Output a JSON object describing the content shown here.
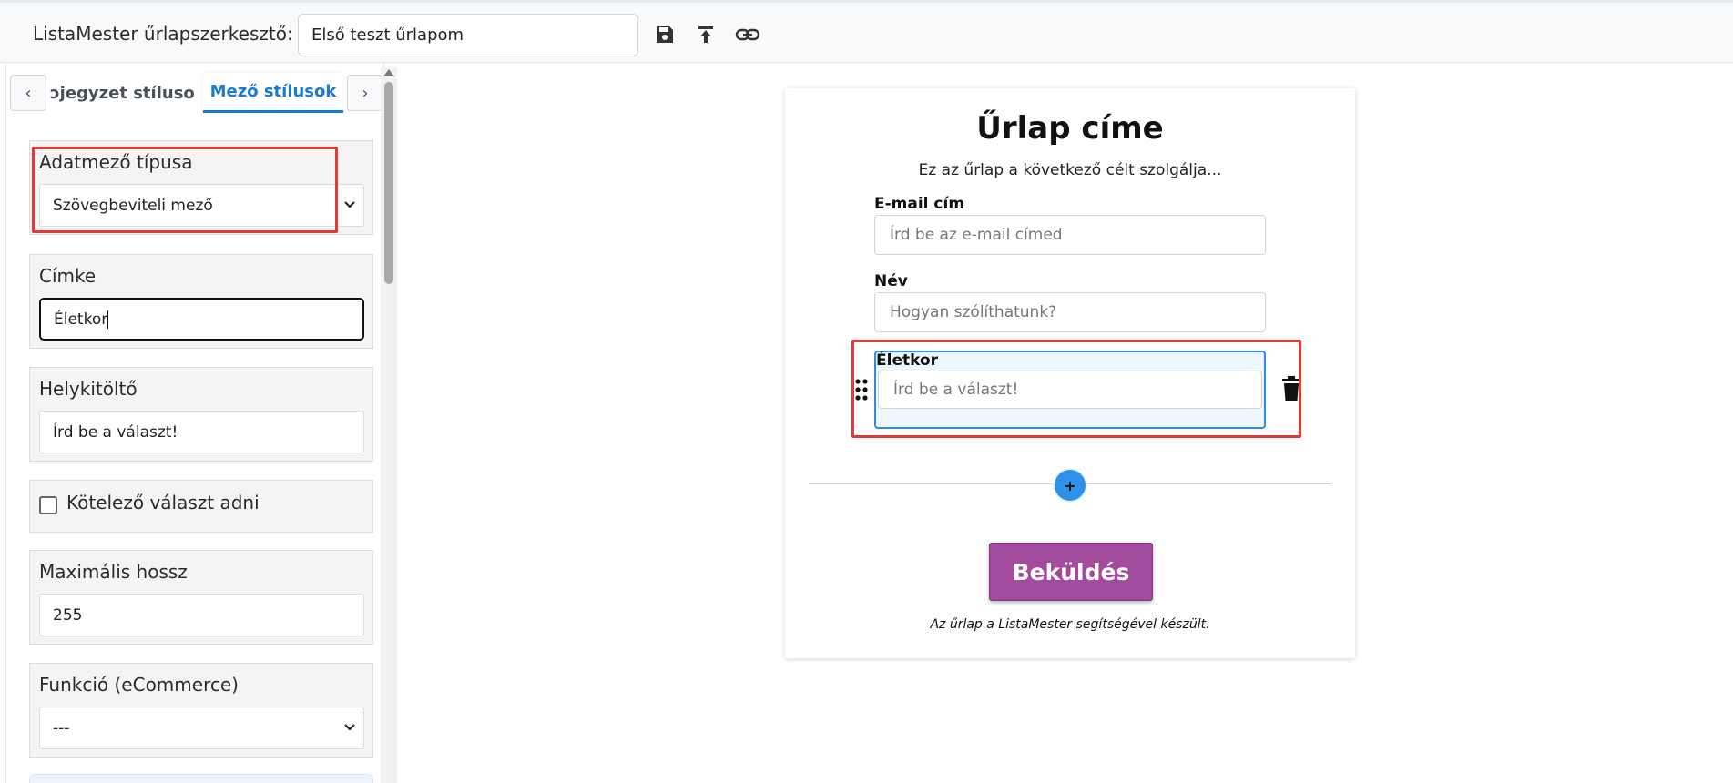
{
  "header": {
    "app_title": "ListaMester űrlapszerkesztő:",
    "form_name_value": "Első teszt űrlapom",
    "icons": [
      "save-icon",
      "upload-icon",
      "link-icon"
    ]
  },
  "panel": {
    "tab_prev_label": "ɔjegyzet stílusok",
    "tab_active_label": "Mező stílusok",
    "arrow_left": "‹",
    "arrow_right": "›",
    "field_type": {
      "label": "Adatmező típusa",
      "value": "Szövegbeviteli mező"
    },
    "label_field": {
      "label": "Címke",
      "value": "Életkor"
    },
    "placeholder_field": {
      "label": "Helykitöltő",
      "value": "Írd be a választ!"
    },
    "required": {
      "label": "Kötelező választ adni",
      "checked": false
    },
    "max_length": {
      "label": "Maximális hossz",
      "value": "255"
    },
    "function": {
      "label": "Funkció (eCommerce)",
      "value": "---"
    }
  },
  "form": {
    "title": "Űrlap címe",
    "subtitle": "Ez az űrlap a következő célt szolgálja...",
    "fields": [
      {
        "label": "E-mail cím",
        "placeholder": "Írd be az e-mail címed"
      },
      {
        "label": "Név",
        "placeholder": "Hogyan szólíthatunk?"
      },
      {
        "label": "Életkor",
        "placeholder": "Írd be a választ!"
      }
    ],
    "add_label": "+",
    "submit_label": "Beküldés",
    "footer": "Az űrlap a ListaMester segítségével készült."
  },
  "colors": {
    "accent": "#1b79d0",
    "submit": "#a24b9c",
    "highlight": "#e53935",
    "add_button": "#2d91e8"
  }
}
